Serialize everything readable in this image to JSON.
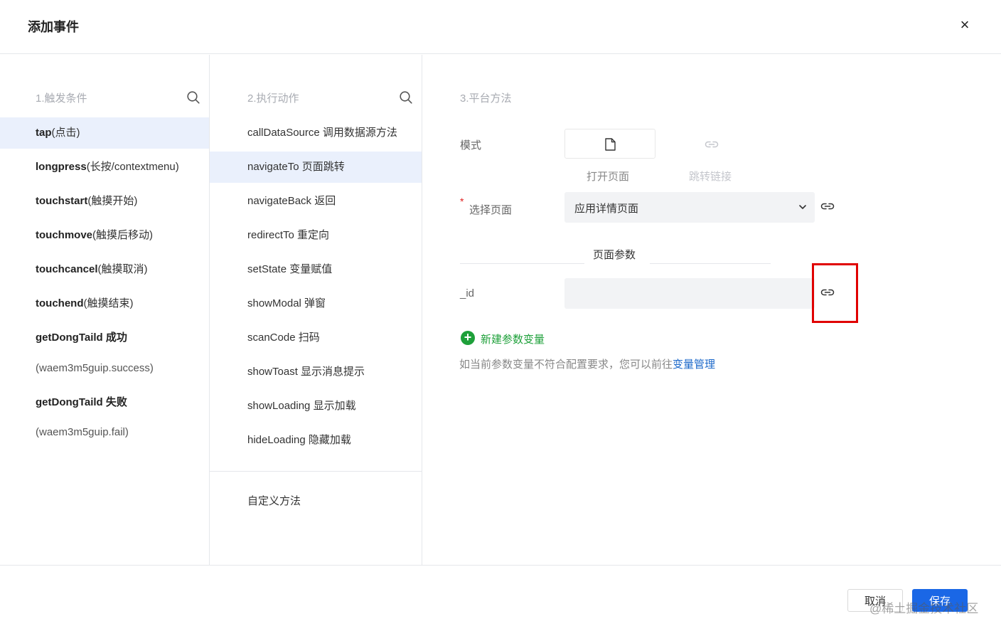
{
  "dialog": {
    "title": "添加事件",
    "close_icon": "×"
  },
  "triggers": {
    "header": "1.触发条件",
    "items": [
      {
        "name": "tap",
        "desc": "(点击)"
      },
      {
        "name": "longpress",
        "desc": "(长按/contextmenu)"
      },
      {
        "name": "touchstart",
        "desc": "(触摸开始)"
      },
      {
        "name": "touchmove",
        "desc": "(触摸后移动)"
      },
      {
        "name": "touchcancel",
        "desc": "(触摸取消)"
      },
      {
        "name": "touchend",
        "desc": "(触摸结束)"
      },
      {
        "name": "getDongTaild 成功",
        "desc": "(waem3m5guip.success)"
      },
      {
        "name": "getDongTaild 失败",
        "desc": "(waem3m5guip.fail)"
      }
    ],
    "selected_index": 0
  },
  "actions": {
    "header": "2.执行动作",
    "items": [
      "callDataSource 调用数据源方法",
      "navigateTo 页面跳转",
      "navigateBack 返回",
      "redirectTo 重定向",
      "setState 变量赋值",
      "showModal 弹窗",
      "scanCode 扫码",
      "showToast 显示消息提示",
      "showLoading 显示加载",
      "hideLoading 隐藏加载"
    ],
    "custom": "自定义方法",
    "selected_index": 1
  },
  "platform": {
    "header": "3.平台方法",
    "mode_label": "模式",
    "mode_open": "打开页面",
    "mode_link": "跳转链接",
    "select_page_label": "选择页面",
    "required_mark": "*",
    "select_page_value": "应用详情页面",
    "params_section": "页面参数",
    "param_name": "_id",
    "param_value": "",
    "add_param": "新建参数变量",
    "hint_prefix": "如当前参数变量不符合配置要求，您可以前往",
    "hint_link": "变量管理"
  },
  "footer": {
    "cancel": "取消",
    "save": "保存",
    "watermark": "@稀土掘金技术社区"
  },
  "colors": {
    "accent": "#1a67e6",
    "selected_bg": "#eaf0fc",
    "add_green": "#1ea03a",
    "highlight_red": "#e00000"
  }
}
